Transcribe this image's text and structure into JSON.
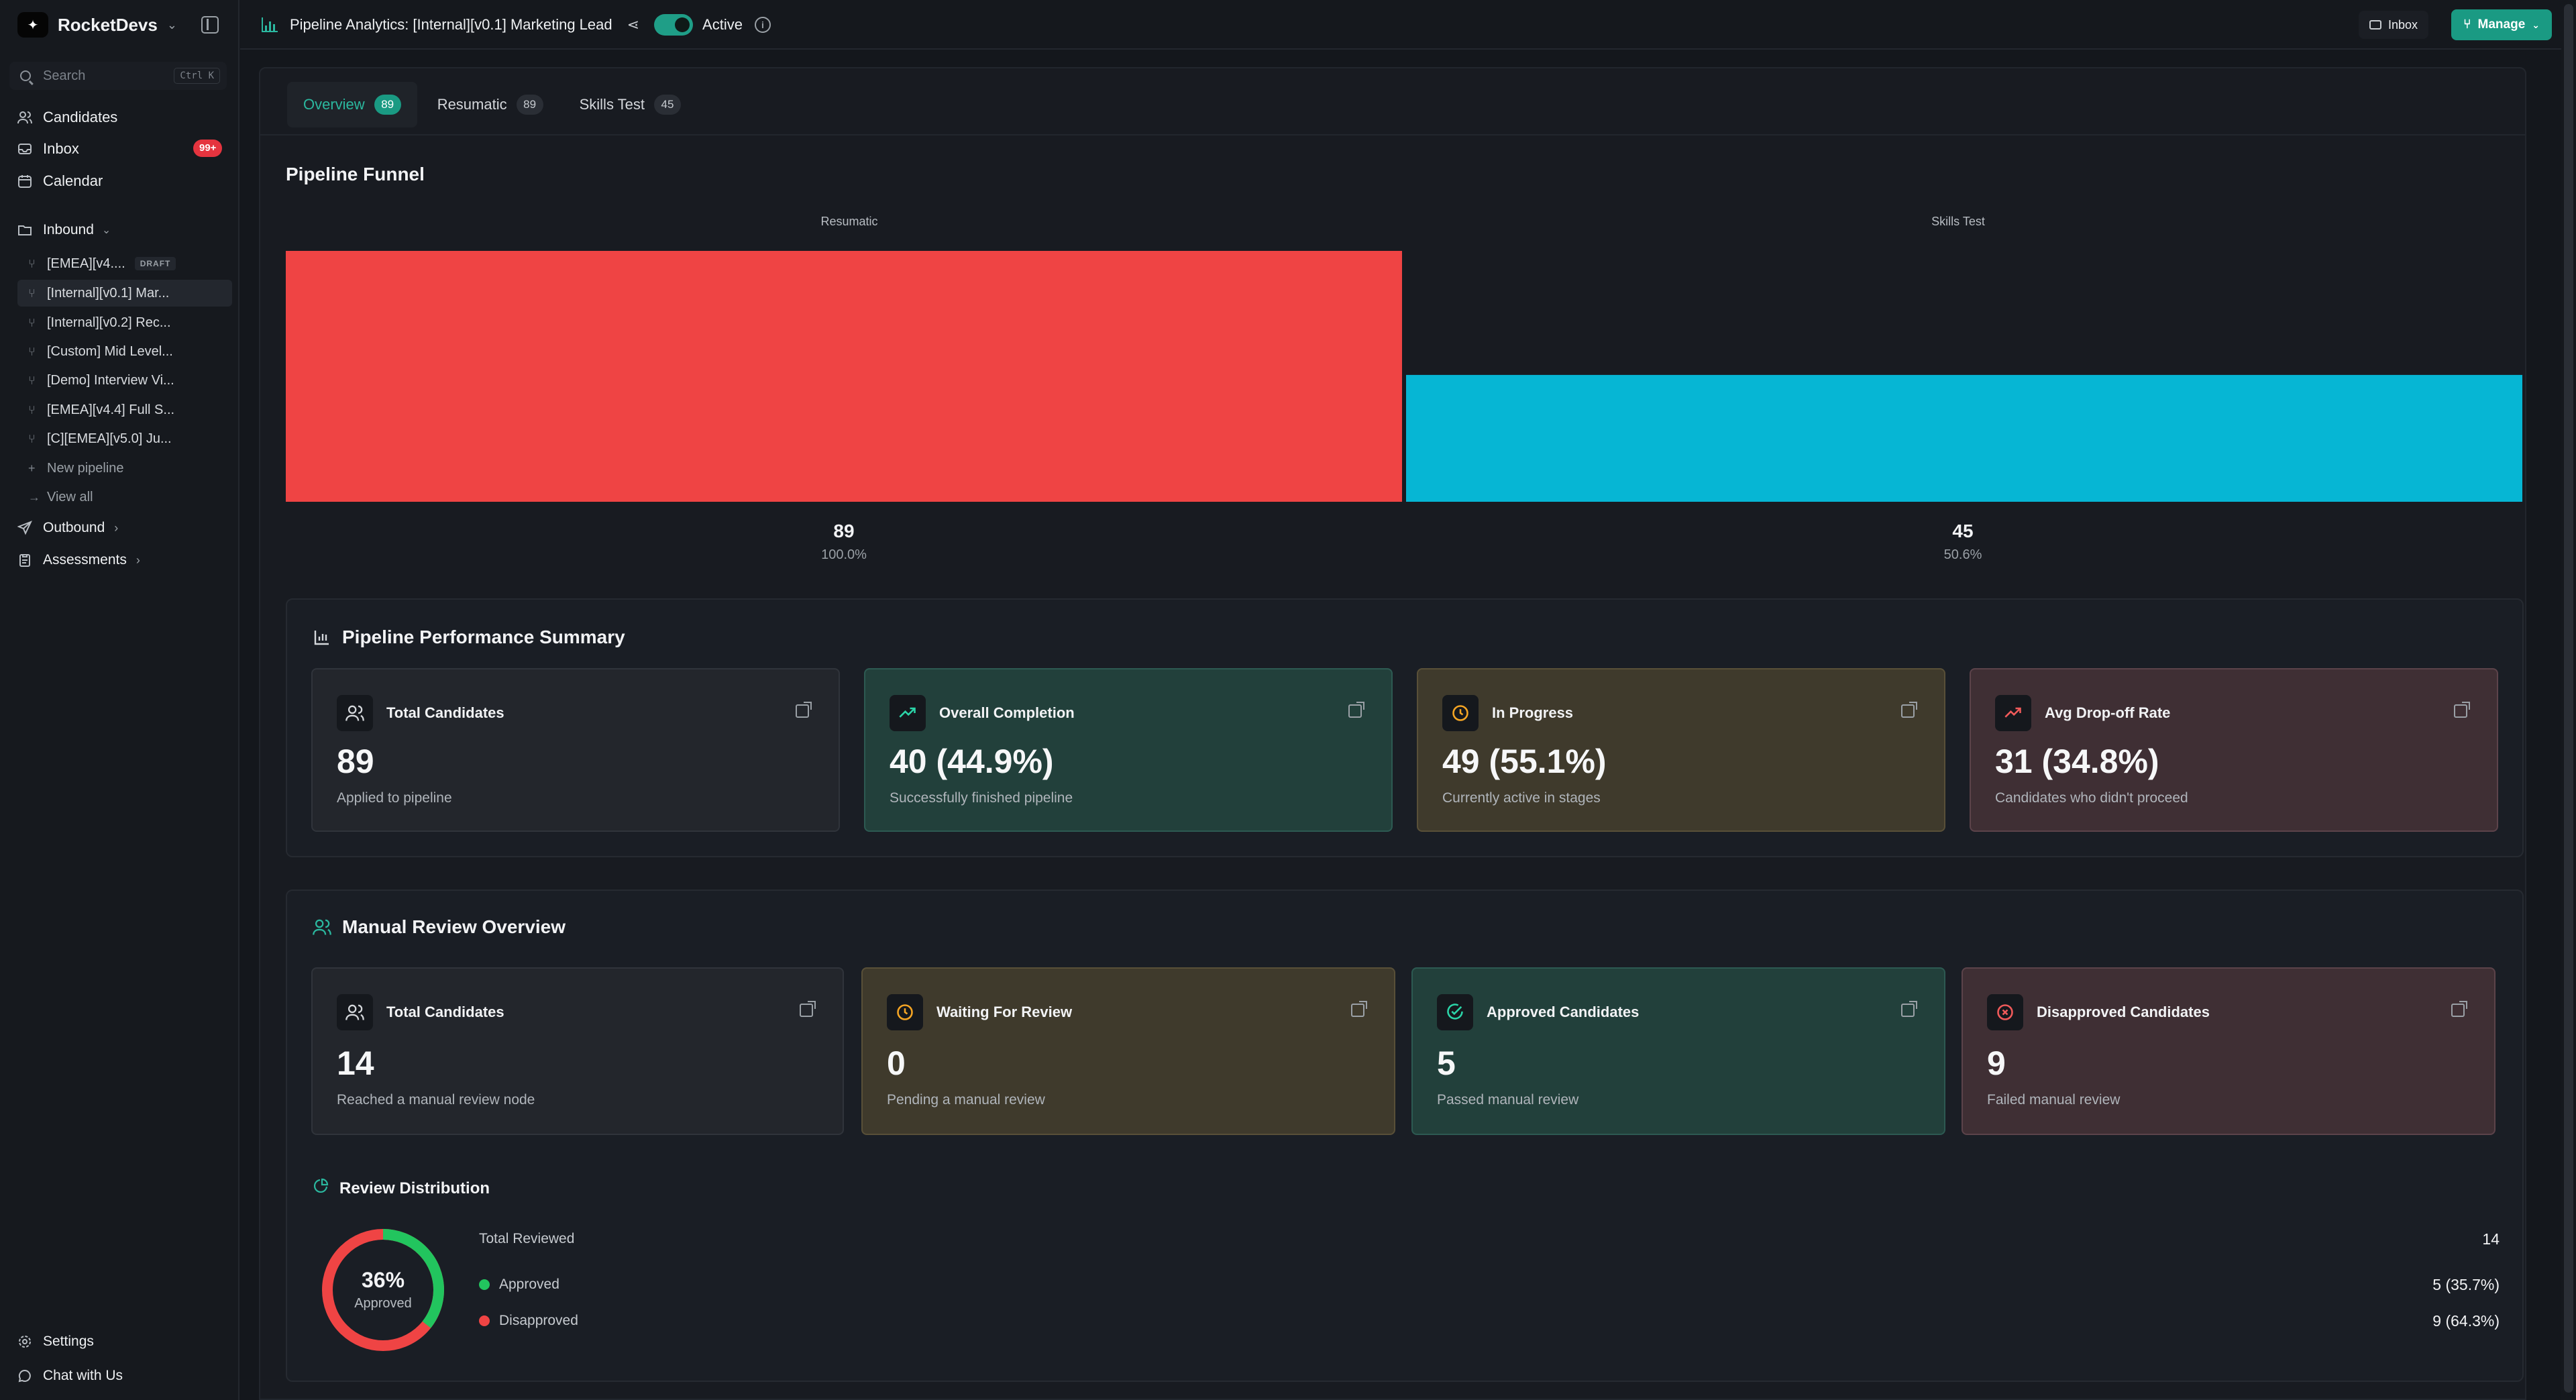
{
  "sidebar": {
    "brand": "RocketDevs",
    "search_placeholder": "Search",
    "search_shortcut": "Ctrl K",
    "nav": [
      {
        "label": "Candidates"
      },
      {
        "label": "Inbox",
        "badge": "99+"
      },
      {
        "label": "Calendar"
      }
    ],
    "inbound_label": "Inbound",
    "pipelines": [
      {
        "label": "[EMEA][v4....",
        "tag": "DRAFT"
      },
      {
        "label": "[Internal][v0.1] Mar..."
      },
      {
        "label": "[Internal][v0.2] Rec..."
      },
      {
        "label": "[Custom] Mid Level..."
      },
      {
        "label": "[Demo] Interview Vi..."
      },
      {
        "label": "[EMEA][v4.4] Full S..."
      },
      {
        "label": "[C][EMEA][v5.0] Ju..."
      }
    ],
    "new_pipeline": "New pipeline",
    "view_all": "View all",
    "outbound_label": "Outbound",
    "assessments_label": "Assessments",
    "settings_label": "Settings",
    "chat_label": "Chat with Us"
  },
  "header": {
    "title": "Pipeline Analytics: [Internal][v0.1] Marketing Lead",
    "status": "Active",
    "inbox_label": "Inbox",
    "manage_label": "Manage"
  },
  "tabs": [
    {
      "label": "Overview",
      "count": "89"
    },
    {
      "label": "Resumatic",
      "count": "89"
    },
    {
      "label": "Skills Test",
      "count": "45"
    }
  ],
  "funnel": {
    "title": "Pipeline Funnel",
    "stages": [
      {
        "name": "Resumatic",
        "count": "89",
        "pct": "100.0%",
        "color": "#ef4444"
      },
      {
        "name": "Skills Test",
        "count": "45",
        "pct": "50.6%",
        "color": "#06b6d4"
      }
    ]
  },
  "performance": {
    "title": "Pipeline Performance Summary",
    "cards": [
      {
        "title": "Total Candidates",
        "value": "89",
        "sub": "Applied to pipeline"
      },
      {
        "title": "Overall Completion",
        "value": "40 (44.9%)",
        "sub": "Successfully finished pipeline"
      },
      {
        "title": "In Progress",
        "value": "49 (55.1%)",
        "sub": "Currently active in stages"
      },
      {
        "title": "Avg Drop-off Rate",
        "value": "31 (34.8%)",
        "sub": "Candidates who didn't proceed"
      }
    ]
  },
  "manual_review": {
    "title": "Manual Review Overview",
    "cards": [
      {
        "title": "Total Candidates",
        "value": "14",
        "sub": "Reached a manual review node"
      },
      {
        "title": "Waiting For Review",
        "value": "0",
        "sub": "Pending a manual review"
      },
      {
        "title": "Approved Candidates",
        "value": "5",
        "sub": "Passed manual review"
      },
      {
        "title": "Disapproved Candidates",
        "value": "9",
        "sub": "Failed manual review"
      }
    ],
    "distribution": {
      "title": "Review Distribution",
      "donut_pct": "36%",
      "donut_label": "Approved",
      "approved_fraction": 0.357,
      "total_label": "Total Reviewed",
      "total_value": "14",
      "approved_label": "Approved",
      "approved_value": "5 (35.7%)",
      "disapproved_label": "Disapproved",
      "disapproved_value": "9 (64.3%)",
      "approved_color": "#22c55e",
      "disapproved_color": "#ef4444"
    }
  }
}
